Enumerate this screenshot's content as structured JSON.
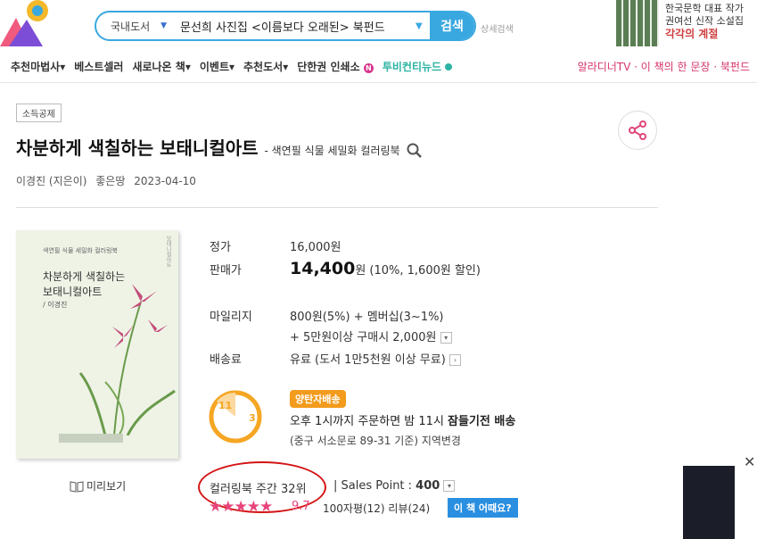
{
  "search": {
    "category": "국내도서",
    "query": "문선희 사진집 <이름보다 오래된> 북펀드",
    "button": "검색",
    "detail": "상세검색"
  },
  "promo": {
    "line1": "한국문학 대표 작가",
    "line2": "권여선 신작 소설집",
    "line3": "각각의 계절"
  },
  "nav": {
    "items": [
      "추천마법사",
      "베스트셀러",
      "새로나온 책",
      "이벤트",
      "추천도서",
      "단한권 인쇄소",
      "투비컨티뉴드"
    ],
    "right": "알라디너TV · 이 책의 한 문장 · 북펀드"
  },
  "book": {
    "tag": "소득공제",
    "title": "차분하게 색칠하는 보태니컬아트",
    "subtitle": "- 색연필 식물 세밀화 컬러링북",
    "author": "이경진 (지은이)",
    "publisher": "좋은땅",
    "date": "2023-04-10",
    "cover_small": "색연필 식물 세밀화 컬러링북",
    "cover_title_1": "차분하게 색칠하는",
    "cover_title_2": "보태니컬아트",
    "cover_author": "/ 이경진",
    "preview": "미리보기"
  },
  "price": {
    "list_label": "정가",
    "list_value": "16,000원",
    "sale_label": "판매가",
    "sale_value": "14,400",
    "sale_unit": "원 (10%, 1,600원 할인)",
    "mileage_label": "마일리지",
    "mileage_value": "800원(5%) + 멤버십(3~1%)",
    "mileage_extra": "+ 5만원이상 구매시 2,000원",
    "ship_label": "배송료",
    "ship_value": "유료 (도서 1만5천원 이상 무료)"
  },
  "delivery": {
    "badge": "양탄자배송",
    "line1_pre": "오후 1시까지 주문하면 밤 11시 ",
    "line1_bold": "잠들기전 배송",
    "line2_pre": "(중구 서소문로 89-31 기준) ",
    "line2_link": "지역변경",
    "clock_11": "11",
    "clock_3": "3"
  },
  "rank": {
    "text": "컬러링북 주간 32위",
    "sales_label": "Sales Point : ",
    "sales_value": "400",
    "stars": "★★★★★",
    "rating": "9.7",
    "review_text": "100자평(12)  리뷰(24)",
    "how_button": "이 책 어때요?"
  }
}
